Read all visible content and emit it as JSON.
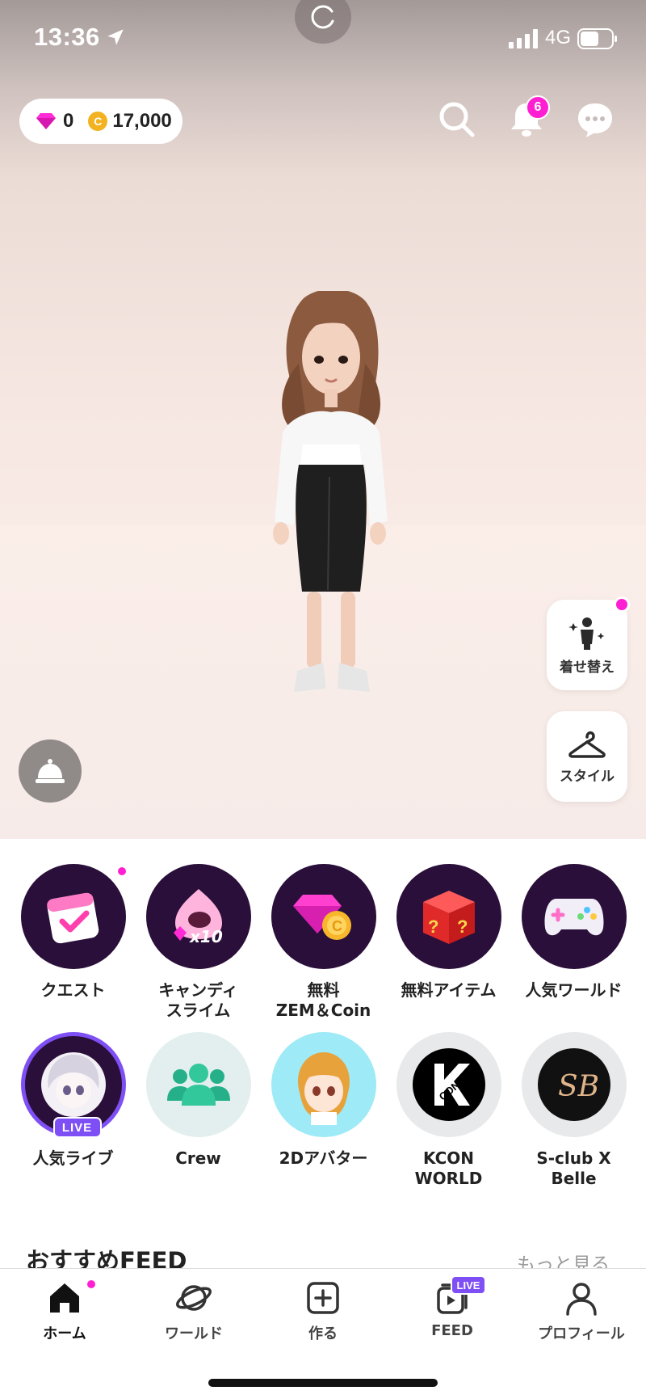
{
  "status_bar": {
    "time": "13:36",
    "network": "4G"
  },
  "currency": {
    "zem": "0",
    "coin": "17,000",
    "coin_symbol": "C"
  },
  "notifications": {
    "badge_count": "6"
  },
  "side_buttons": {
    "dressup_label": "着せ替え",
    "style_label": "スタイル"
  },
  "shortcuts": [
    {
      "label": "クエスト",
      "icon": "calendar-check-icon"
    },
    {
      "label": "キャンディ\nスライム",
      "icon": "slime-icon"
    },
    {
      "label": "無料\nZEM＆Coin",
      "icon": "gem-coin-icon"
    },
    {
      "label": "無料アイテム",
      "icon": "mystery-box-icon"
    },
    {
      "label": "人気ワールド",
      "icon": "gamepad-icon"
    },
    {
      "label": "人気ライブ",
      "icon": "live-avatar-icon",
      "badge": "LIVE"
    },
    {
      "label": "Crew",
      "icon": "crew-icon"
    },
    {
      "label": "2Dアバター",
      "icon": "2d-avatar-icon"
    },
    {
      "label": "KCON\nWORLD",
      "icon": "kcon-logo-icon",
      "logo_text": "CON"
    },
    {
      "label": "S-club X\nBelle",
      "icon": "sb-logo-icon",
      "logo_text": "SB"
    }
  ],
  "feed_section": {
    "title": "おすすめFEED",
    "more": "もっと見る"
  },
  "bottom_nav": [
    {
      "label": "ホーム",
      "icon": "home-icon",
      "active": true
    },
    {
      "label": "ワールド",
      "icon": "planet-icon"
    },
    {
      "label": "作る",
      "icon": "plus-square-icon"
    },
    {
      "label": "FEED",
      "icon": "feed-icon",
      "badge": "LIVE"
    },
    {
      "label": "プロフィール",
      "icon": "person-icon"
    }
  ],
  "colors": {
    "accent_pink": "#ff1fd2",
    "live_purple": "#7f4ff6",
    "shortcut_dark": "#2a0f3a"
  }
}
